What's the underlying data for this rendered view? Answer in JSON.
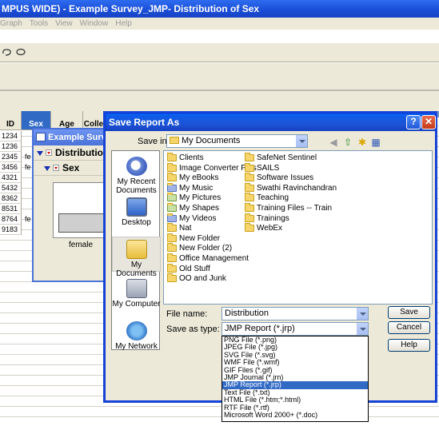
{
  "main_window": {
    "title": "MPUS WIDE)  - Example Survey_JMP- Distribution of Sex",
    "menu": [
      "Graph",
      "Tools",
      "View",
      "Window",
      "Help"
    ]
  },
  "grid": {
    "columns": [
      "ID",
      "Sex",
      "Age",
      "Colle"
    ],
    "ids": [
      "1234",
      "1236",
      "2345",
      "3456",
      "4321",
      "5432",
      "8362",
      "8531",
      "8764",
      "9183"
    ],
    "sex_cells": [
      "",
      "",
      "fe",
      "fe",
      "",
      "",
      "",
      "",
      "fe",
      ""
    ]
  },
  "report_window": {
    "title": "Example Survey",
    "outline_1": "Distribution",
    "outline_2": "Sex",
    "axis_label": "female"
  },
  "dialog": {
    "title": "Save Report As",
    "save_in_label": "Save in:",
    "save_in_value": "My Documents",
    "places": [
      "My Recent Documents",
      "Desktop",
      "My Documents",
      "My Computer",
      "My Network"
    ],
    "files_col1": [
      "Clients",
      "Image Converter Plus",
      "My eBooks",
      "My Music",
      "My Pictures",
      "My Shapes",
      "My Videos",
      "Nat",
      "New Folder",
      "New Folder (2)",
      "Office Management",
      "Old Stuff",
      "OO and Junk"
    ],
    "files_col2": [
      "SafeNet Sentinel",
      "SAILS",
      "Software Issues",
      "Swathi Ravinchandran",
      "Teaching",
      "Training Files -- Train",
      "Trainings",
      "WebEx"
    ],
    "file_name_label": "File name:",
    "file_name_value": "Distribution",
    "save_type_label": "Save as type:",
    "save_type_value": "JMP Report (*.jrp)",
    "save_button": "Save",
    "cancel_button": "Cancel",
    "help_button": "Help",
    "type_options": [
      "PNG File (*.png)",
      "JPEG File (*.jpg)",
      "SVG File (*.svg)",
      "WMF File (*.wmf)",
      "GIF Files (*.gif)",
      "JMP Journal (*.jrn)",
      "JMP Report (*.jrp)",
      "Text File (*.txt)",
      "HTML File (*.htm;*.html)",
      "RTF File (*.rtf)",
      "Microsoft Word 2000+ (*.doc)"
    ],
    "type_selected_index": 6
  }
}
